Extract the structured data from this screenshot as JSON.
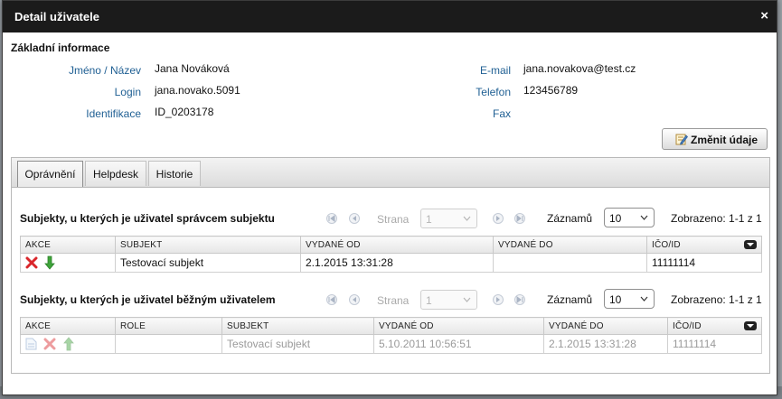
{
  "dialog": {
    "title": "Detail uživatele",
    "close_glyph": "×"
  },
  "basic": {
    "heading": "Základní informace",
    "left": [
      {
        "label": "Jméno / Název",
        "value": "Jana Nováková"
      },
      {
        "label": "Login",
        "value": "jana.novako.5091"
      },
      {
        "label": "Identifikace",
        "value": "ID_0203178"
      }
    ],
    "right": [
      {
        "label": "E-mail",
        "value": "jana.novakova@test.cz"
      },
      {
        "label": "Telefon",
        "value": "123456789"
      },
      {
        "label": "Fax",
        "value": ""
      }
    ],
    "change_button": "Změnit údaje",
    "change_icon": "edit-note-icon"
  },
  "tabs": [
    {
      "label": "Oprávnění",
      "active": true
    },
    {
      "label": "Helpdesk",
      "active": false
    },
    {
      "label": "Historie",
      "active": false
    }
  ],
  "pager": {
    "page_label": "Strana",
    "page_value": "1",
    "records_label": "Záznamů",
    "records_value": "10",
    "icons": [
      "first-page-icon",
      "prev-page-icon",
      "next-page-icon",
      "last-page-icon"
    ]
  },
  "admin_section": {
    "heading": "Subjekty, u kterých je uživatel správcem subjektu",
    "shown": "Zobrazeno: 1-1 z 1",
    "columns": [
      "AKCE",
      "SUBJEKT",
      "VYDANÉ OD",
      "VYDANÉ DO",
      "IČO/ID"
    ],
    "rows": [
      {
        "actions": [
          "delete-icon",
          "download-arrow-icon"
        ],
        "subject": "Testovací subjekt",
        "from": "2.1.2015 13:31:28",
        "to": "",
        "ico": "11111114"
      }
    ]
  },
  "user_section": {
    "heading": "Subjekty, u kterých je uživatel běžným uživatelem",
    "shown": "Zobrazeno: 1-1 z 1",
    "columns": [
      "AKCE",
      "ROLE",
      "SUBJEKT",
      "VYDANÉ OD",
      "VYDANÉ DO",
      "IČO/ID"
    ],
    "rows": [
      {
        "actions": [
          "document-icon",
          "delete-icon",
          "upload-arrow-icon"
        ],
        "role": "",
        "subject": "Testovací subjekt",
        "from": "5.10.2011 10:56:51",
        "to": "2.1.2015 13:31:28",
        "ico": "11111114"
      }
    ]
  },
  "colors": {
    "titlebar": "#1b1b1b",
    "label_blue": "#1f5f93",
    "delete_red": "#d9262b",
    "arrow_green": "#3ea43a"
  }
}
